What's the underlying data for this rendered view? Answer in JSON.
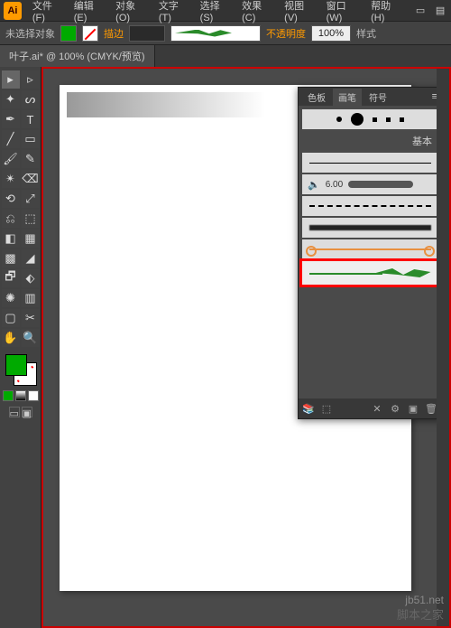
{
  "app": {
    "logo": "Ai"
  },
  "menu": {
    "file": "文件(F)",
    "edit": "编辑(E)",
    "object": "对象(O)",
    "type": "文字(T)",
    "select": "选择(S)",
    "effect": "效果(C)",
    "view": "视图(V)",
    "window": "窗口(W)",
    "help": "帮助(H)"
  },
  "control": {
    "noselection": "未选择对象",
    "stroke_link": "描边",
    "stroke_weight": "",
    "opacity_label": "不透明度",
    "opacity_value": "100%",
    "style_label": "样式"
  },
  "doc": {
    "tab": "叶子.ai* @ 100% (CMYK/预览)"
  },
  "brushes": {
    "tabs": {
      "swatches": "色板",
      "brushes": "画笔",
      "symbols": "符号"
    },
    "basic_label": "基本",
    "size_value": "6.00"
  },
  "watermark": {
    "site": "jb51.net",
    "name": "脚本之家"
  }
}
